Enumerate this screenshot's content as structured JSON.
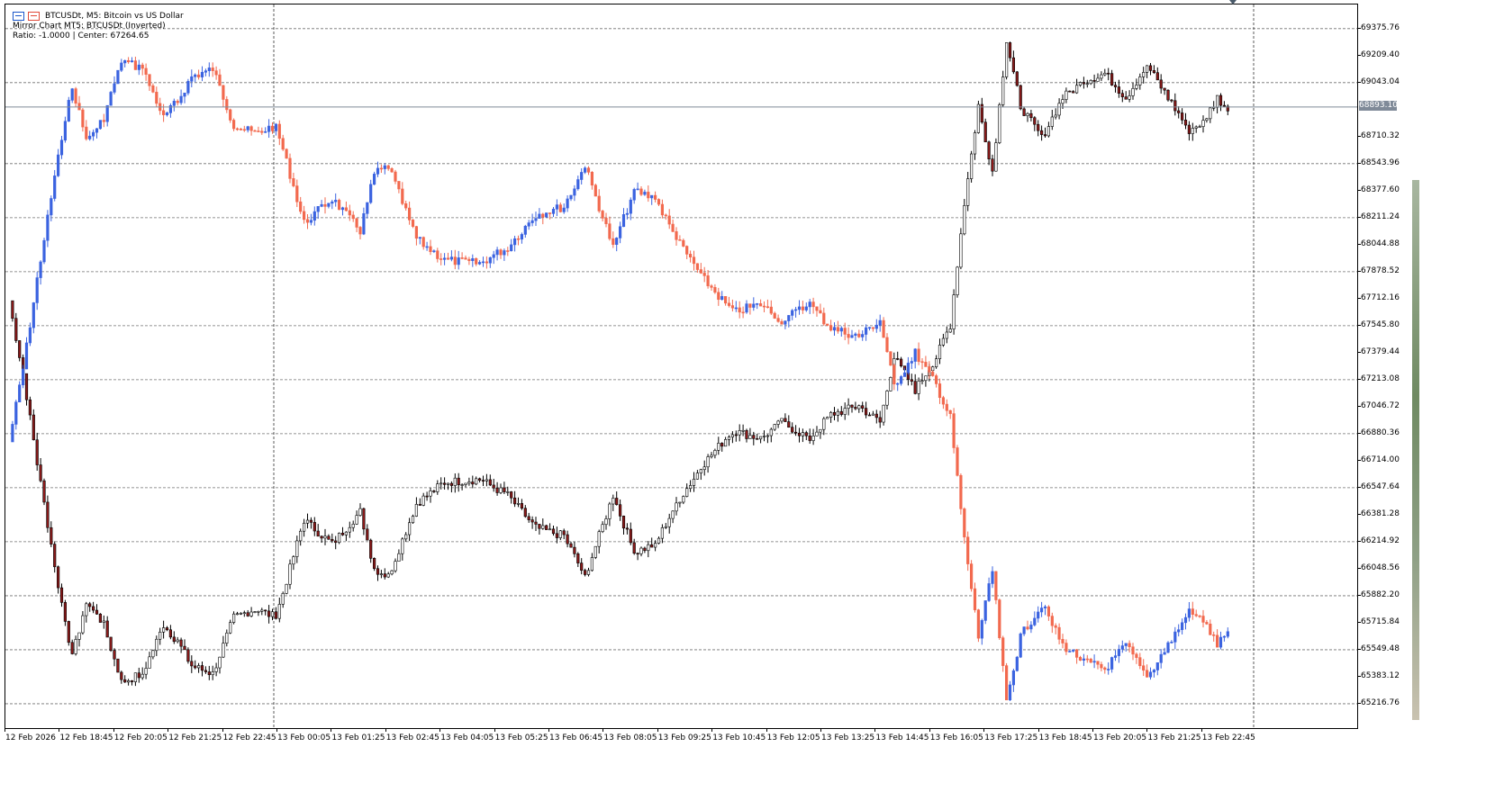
{
  "header": {
    "title": "BTCUSDt, M5:  Bitcoin vs US Dollar",
    "line1": "Mirror Chart MT5: BTCUSDt (Inverted)",
    "line2": "Ratio: -1.0000 | Center: 67264.65"
  },
  "price_axis": {
    "labels": [
      "69375.76",
      "69209.40",
      "69043.04",
      "68710.32",
      "68543.96",
      "68377.60",
      "68211.24",
      "68044.88",
      "67878.52",
      "67712.16",
      "67545.80",
      "67379.44",
      "67213.08",
      "67046.72",
      "66880.36",
      "66714.00",
      "66547.64",
      "66381.28",
      "66214.92",
      "66048.56",
      "65882.20",
      "65715.84",
      "65549.48",
      "65383.12",
      "65216.76"
    ],
    "current_price": "68893.10"
  },
  "time_axis": {
    "labels": [
      "12 Feb 2026",
      "12 Feb 18:45",
      "12 Feb 20:05",
      "12 Feb 21:25",
      "12 Feb 22:45",
      "13 Feb 00:05",
      "13 Feb 01:25",
      "13 Feb 02:45",
      "13 Feb 04:05",
      "13 Feb 05:25",
      "13 Feb 06:45",
      "13 Feb 08:05",
      "13 Feb 09:25",
      "13 Feb 10:45",
      "13 Feb 12:05",
      "13 Feb 13:25",
      "13 Feb 14:45",
      "13 Feb 16:05",
      "13 Feb 17:25",
      "13 Feb 18:45",
      "13 Feb 20:05",
      "13 Feb 21:25",
      "13 Feb 22:45"
    ]
  },
  "colors": {
    "bull_main": "#000000",
    "bear_main": "#000000",
    "bear_main_fill": "#8b1a1a",
    "bull_mirror": "#3b63e0",
    "bear_mirror": "#f2694e",
    "grid": "#707070",
    "current_line": "#7f8a98"
  },
  "chart_data": {
    "type": "candlestick",
    "symbol": "BTCUSDt",
    "timeframe": "M5",
    "mirror_center": 67264.65,
    "mirror_ratio": -1.0,
    "ylim": [
      65100,
      69480
    ],
    "anchors": [
      {
        "i": 0,
        "close": 67700
      },
      {
        "i": 4,
        "close": 67250
      },
      {
        "i": 8,
        "close": 66700
      },
      {
        "i": 14,
        "close": 65950
      },
      {
        "i": 18,
        "close": 65500
      },
      {
        "i": 22,
        "close": 65850
      },
      {
        "i": 27,
        "close": 65700
      },
      {
        "i": 32,
        "close": 65350
      },
      {
        "i": 38,
        "close": 65400
      },
      {
        "i": 44,
        "close": 65700
      },
      {
        "i": 48,
        "close": 65600
      },
      {
        "i": 52,
        "close": 65450
      },
      {
        "i": 58,
        "close": 65400
      },
      {
        "i": 64,
        "close": 65750
      },
      {
        "i": 70,
        "close": 65800
      },
      {
        "i": 76,
        "close": 65750
      },
      {
        "i": 84,
        "close": 66350
      },
      {
        "i": 92,
        "close": 66200
      },
      {
        "i": 100,
        "close": 66400
      },
      {
        "i": 104,
        "close": 66050
      },
      {
        "i": 108,
        "close": 66000
      },
      {
        "i": 116,
        "close": 66450
      },
      {
        "i": 124,
        "close": 66580
      },
      {
        "i": 134,
        "close": 66600
      },
      {
        "i": 142,
        "close": 66500
      },
      {
        "i": 150,
        "close": 66300
      },
      {
        "i": 158,
        "close": 66250
      },
      {
        "i": 164,
        "close": 66000
      },
      {
        "i": 172,
        "close": 66500
      },
      {
        "i": 178,
        "close": 66150
      },
      {
        "i": 184,
        "close": 66200
      },
      {
        "i": 190,
        "close": 66450
      },
      {
        "i": 198,
        "close": 66700
      },
      {
        "i": 206,
        "close": 66900
      },
      {
        "i": 214,
        "close": 66850
      },
      {
        "i": 220,
        "close": 66950
      },
      {
        "i": 228,
        "close": 66850
      },
      {
        "i": 234,
        "close": 67000
      },
      {
        "i": 242,
        "close": 67050
      },
      {
        "i": 248,
        "close": 66950
      },
      {
        "i": 252,
        "close": 67350
      },
      {
        "i": 258,
        "close": 67150
      },
      {
        "i": 264,
        "close": 67350
      },
      {
        "i": 268,
        "close": 67550
      },
      {
        "i": 272,
        "close": 68300
      },
      {
        "i": 276,
        "close": 68900
      },
      {
        "i": 280,
        "close": 68500
      },
      {
        "i": 284,
        "close": 69300
      },
      {
        "i": 288,
        "close": 68900
      },
      {
        "i": 294,
        "close": 68700
      },
      {
        "i": 300,
        "close": 68950
      },
      {
        "i": 306,
        "close": 69050
      },
      {
        "i": 312,
        "close": 69100
      },
      {
        "i": 318,
        "close": 68950
      },
      {
        "i": 324,
        "close": 69150
      },
      {
        "i": 330,
        "close": 68950
      },
      {
        "i": 336,
        "close": 68750
      },
      {
        "i": 340,
        "close": 68800
      },
      {
        "i": 344,
        "close": 68950
      },
      {
        "i": 347,
        "close": 68880
      }
    ]
  }
}
